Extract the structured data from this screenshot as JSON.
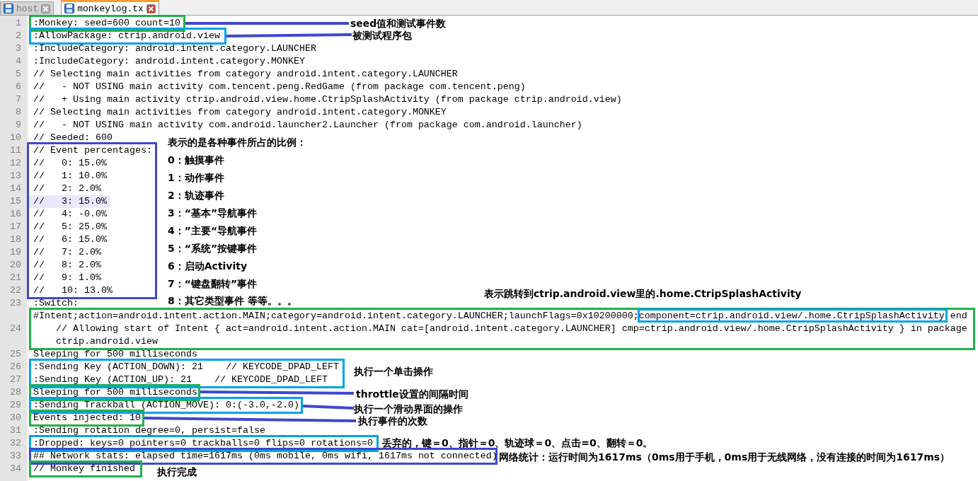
{
  "tabs": [
    {
      "label": "host",
      "selected": false
    },
    {
      "label": "monkeylog.tx",
      "selected": true
    }
  ],
  "lines": [
    {
      "number": "1",
      "text": ":Monkey: seed=600 count=10",
      "current": false
    },
    {
      "number": "2",
      "text": ":AllowPackage: ctrip.android.view",
      "current": false
    },
    {
      "number": "3",
      "text": ":IncludeCategory: android.intent.category.LAUNCHER",
      "current": false
    },
    {
      "number": "4",
      "text": ":IncludeCategory: android.intent.category.MONKEY",
      "current": false
    },
    {
      "number": "5",
      "text": "// Selecting main activities from category android.intent.category.LAUNCHER",
      "current": false
    },
    {
      "number": "6",
      "text": "//   - NOT USING main activity com.tencent.peng.RedGame (from package com.tencent.peng)",
      "current": false
    },
    {
      "number": "7",
      "text": "//   + Using main activity ctrip.android.view.home.CtripSplashActivity (from package ctrip.android.view)",
      "current": false
    },
    {
      "number": "8",
      "text": "// Selecting main activities from category android.intent.category.MONKEY",
      "current": false
    },
    {
      "number": "9",
      "text": "//   - NOT USING main activity com.android.launcher2.Launcher (from package com.android.launcher)",
      "current": false
    },
    {
      "number": "10",
      "text": "// Seeded: 600",
      "current": false
    },
    {
      "number": "11",
      "text": "// Event percentages:",
      "current": false
    },
    {
      "number": "12",
      "text": "//   0: 15.0%",
      "current": false
    },
    {
      "number": "13",
      "text": "//   1: 10.0%",
      "current": false
    },
    {
      "number": "14",
      "text": "//   2: 2.0%",
      "current": false
    },
    {
      "number": "15",
      "text": "//   3: 15.0%",
      "current": true
    },
    {
      "number": "16",
      "text": "//   4: -0.0%",
      "current": false
    },
    {
      "number": "17",
      "text": "//   5: 25.0%",
      "current": false
    },
    {
      "number": "18",
      "text": "//   6: 15.0%",
      "current": false
    },
    {
      "number": "19",
      "text": "//   7: 2.0%",
      "current": false
    },
    {
      "number": "20",
      "text": "//   8: 2.0%",
      "current": false
    },
    {
      "number": "21",
      "text": "//   9: 1.0%",
      "current": false
    },
    {
      "number": "22",
      "text": "//   10: 13.0%",
      "current": false
    },
    {
      "number": "23",
      "text": ":Switch:",
      "current": false
    },
    {
      "number": "24",
      "text": "#Intent;action=android.intent.action.MAIN;category=android.intent.category.LAUNCHER;launchFlags=0x10200000;component=ctrip.android.view/.home.CtripSplashActivity end    // Allowing start of Intent { act=android.intent.action.MAIN cat=[android.intent.category.LAUNCHER] cmp=ctrip.android.view/.home.CtripSplashActivity } in package ctrip.android.view",
      "current": false
    },
    {
      "number": "25",
      "text": "Sleeping for 500 milliseconds",
      "current": false
    },
    {
      "number": "26",
      "text": ":Sending Key (ACTION_DOWN): 21    // KEYCODE_DPAD_LEFT",
      "current": false
    },
    {
      "number": "27",
      "text": ":Sending Key (ACTION_UP): 21    // KEYCODE_DPAD_LEFT",
      "current": false
    },
    {
      "number": "28",
      "text": "Sleeping for 500 milliseconds",
      "current": false
    },
    {
      "number": "29",
      "text": ":Sending Trackball (ACTION_MOVE): 0:(-3.0,-2.0)",
      "current": false
    },
    {
      "number": "30",
      "text": "Events injected: 10",
      "current": false
    },
    {
      "number": "31",
      "text": ":Sending rotation degree=0, persist=false",
      "current": false
    },
    {
      "number": "32",
      "text": ":Dropped: keys=0 pointers=0 trackballs=0 flips=0 rotations=0",
      "current": false
    },
    {
      "number": "33",
      "text": "## Network stats: elapsed time=1617ms (0ms mobile, 0ms wifi, 1617ms not connected)",
      "current": false
    },
    {
      "number": "34",
      "text": "// Monkey finished",
      "current": false
    }
  ],
  "annotation_frames": [
    {
      "color": "#22b14c"
    },
    {
      "color": "#00a2e8"
    },
    {
      "color": "#3f48cc"
    },
    {
      "color": "#22b14c"
    },
    {
      "color": "#00a2e8"
    },
    {
      "color": "#00a2e8"
    },
    {
      "color": "#22b14c"
    },
    {
      "color": "#00a2e8"
    },
    {
      "color": "#22b14c"
    },
    {
      "color": "#00a2e8"
    },
    {
      "color": "#3f48cc"
    },
    {
      "color": "#22b14c"
    }
  ],
  "annotations": [
    {
      "text": "seed值和测试事件数"
    },
    {
      "text": "被测试程序包"
    },
    {
      "text": "表示的是各种事件所占的比例："
    },
    {
      "text": "0：触摸事件"
    },
    {
      "text": "1：动作事件"
    },
    {
      "text": "2：轨迹事件"
    },
    {
      "text": "3：“基本”导航事件"
    },
    {
      "text": "4：”主要“导航事件"
    },
    {
      "text": "5：“系统”按键事件"
    },
    {
      "text": "6：启动Activity"
    },
    {
      "text": "7：“键盘翻转”事件"
    },
    {
      "text": "8：其它类型事件 等等。。。"
    },
    {
      "text": "表示跳转到ctrip.android.view里的.home.CtripSplashActivity"
    },
    {
      "text": "执行一个单击操作"
    },
    {
      "text": "throttle设置的间隔时间"
    },
    {
      "text": "执行一个滑动界面的操作"
    },
    {
      "text": "执行事件的次数"
    },
    {
      "text": "丢弃的，键＝0、指针＝0、轨迹球＝0、点击=0、翻转＝0。"
    },
    {
      "text": "网络统计：运行时间为1617ms（0ms用于手机，0ms用于无线网络，没有连接的时间为1617ms）"
    },
    {
      "text": "执行完成"
    }
  ]
}
